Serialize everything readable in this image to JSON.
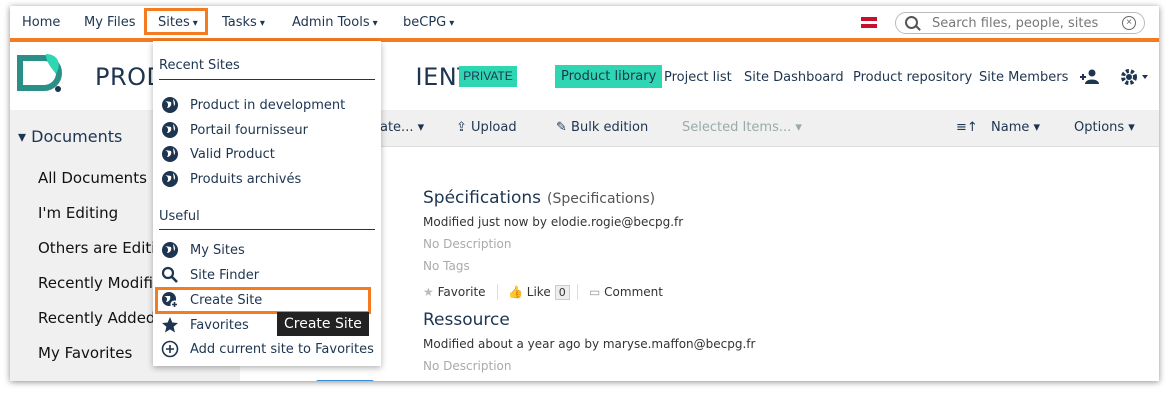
{
  "nav": {
    "home": "Home",
    "my_files": "My Files",
    "sites": "Sites",
    "tasks": "Tasks",
    "admin_tools": "Admin Tools",
    "becpg": "beCPG",
    "caret": "▾",
    "search_placeholder": "Search files, people, sites",
    "clear": "×"
  },
  "site": {
    "title_left": "PROD",
    "title_right": "IENT",
    "visibility": "PRIVATE",
    "links": [
      "Product library",
      "Project list",
      "Site Dashboard",
      "Product repository",
      "Site Members"
    ]
  },
  "toolbar": {
    "create": "eate...",
    "upload": "Upload",
    "bulk_edition": "Bulk edition",
    "selected_items": "Selected Items...",
    "sort_by": "Name",
    "options": "Options"
  },
  "sidebar": {
    "heading": "Documents",
    "items": [
      "All Documents",
      "I'm Editing",
      "Others are Editing",
      "Recently Modified",
      "Recently Added",
      "My Favorites"
    ]
  },
  "documents": [
    {
      "title": "Spécifications",
      "subtitle": "(Specifications)",
      "modified": "Modified just now by elodie.rogie@becpg.fr",
      "description": "No Description",
      "tags": "No Tags",
      "favorite": "Favorite",
      "like": "Like",
      "like_count": "0",
      "comment": "Comment"
    },
    {
      "title": "Ressource",
      "modified": "Modified about a year ago by maryse.maffon@becpg.fr",
      "description": "No Description"
    }
  ],
  "dropdown": {
    "recent_heading": "Recent Sites",
    "recent": [
      "Product in development",
      "Portail fournisseur",
      "Valid Product",
      "Produits archivés"
    ],
    "useful_heading": "Useful",
    "useful": [
      "My Sites",
      "Site Finder",
      "Create Site",
      "Favorites",
      "Add current site to Favorites"
    ]
  },
  "tooltip": "Create Site",
  "colors": {
    "accent": "#f47b20",
    "teal": "#2fd6b2",
    "navy": "#1d3550"
  }
}
